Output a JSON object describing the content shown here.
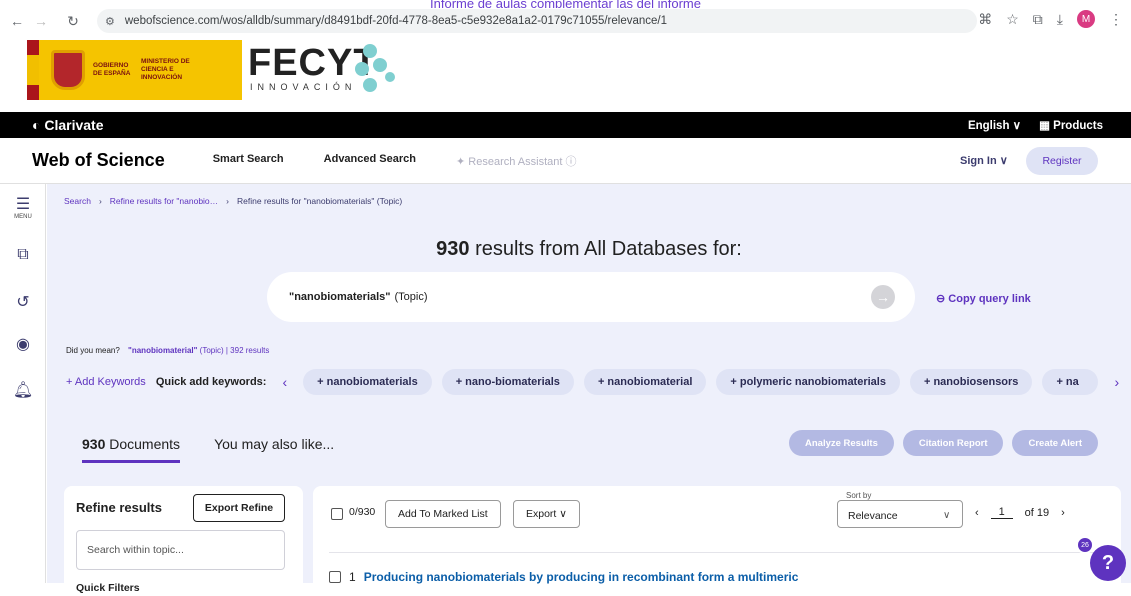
{
  "browser": {
    "banner_text": "Informe de aulas complementar las del informe",
    "url": "webofscience.com/wos/alldb/summary/d8491bdf-20fd-4778-8ea5-c5e932e8a1a2-0179c71055/relevance/1",
    "profile_initial": "M"
  },
  "fecyt": {
    "gov_text": "GOBIERNO DE ESPAÑA",
    "ministry_text": "MINISTERIO DE CIENCIA E INNOVACIÓN",
    "logo": "FECYT",
    "sub": "INNOVACIÓN"
  },
  "clarivate": {
    "logo": "Clarivate",
    "language": "English ∨",
    "products": "Products"
  },
  "header": {
    "logo": "Web of Science",
    "nav": [
      "Smart Search",
      "Advanced Search",
      "Research Assistant"
    ],
    "sign_in": "Sign In ∨",
    "register": "Register"
  },
  "rail": {
    "menu_label": "MENU"
  },
  "breadcrumb": [
    "Search",
    "Refine results for \"nanobio…",
    "Refine results for \"nanobiomaterials\" (Topic)"
  ],
  "results": {
    "count": "930",
    "title_suffix": "results from All Databases for:",
    "query": "\"nanobiomaterials\"",
    "query_field": "(Topic)",
    "copy_link": "Copy query link"
  },
  "did_you_mean": {
    "label": "Did you mean?",
    "suggestion": "\"nanobiomaterial\"",
    "suggestion_meta": "(Topic) | 392 results"
  },
  "keywords": {
    "add": "+ Add Keywords",
    "quick_label": "Quick add keywords:",
    "chips": [
      "+ nanobiomaterials",
      "+ nano-biomaterials",
      "+ nanobiomaterial",
      "+ polymeric nanobiomaterials",
      "+ nanobiosensors",
      "+ na"
    ]
  },
  "tabs": {
    "documents_count": "930",
    "documents_label": "Documents",
    "also_like": "You may also like..."
  },
  "actions": [
    "Analyze Results",
    "Citation Report",
    "Create Alert"
  ],
  "refine": {
    "title": "Refine results",
    "export": "Export Refine",
    "search_placeholder": "Search within topic...",
    "quick_filters": "Quick Filters"
  },
  "toolbar": {
    "selected": "0/930",
    "add_marked": "Add To Marked List",
    "export": "Export ∨",
    "sort_label": "Sort by",
    "sort_value": "Relevance",
    "page": "1",
    "page_total": "of 19"
  },
  "first_result": {
    "index": "1",
    "title": "Producing nanobiomaterials by producing in recombinant form a multimeric"
  },
  "help": {
    "badge": "26",
    "icon": "?"
  }
}
